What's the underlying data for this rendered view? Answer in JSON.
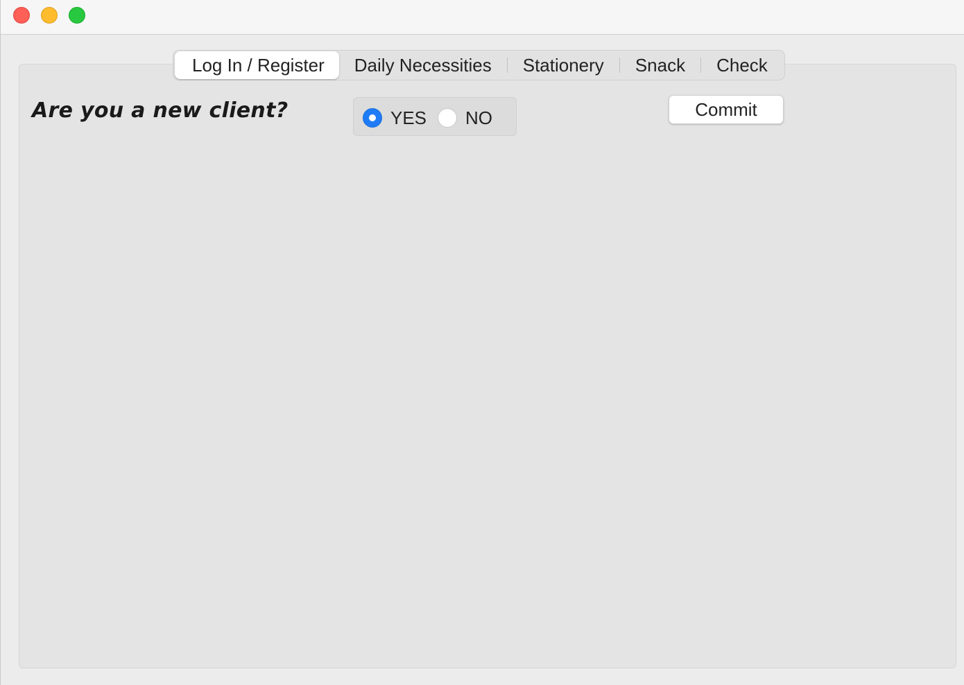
{
  "window": {
    "controls": [
      "close",
      "minimize",
      "maximize"
    ]
  },
  "tabs": [
    {
      "label": "Log In / Register",
      "selected": true
    },
    {
      "label": "Daily Necessities",
      "selected": false
    },
    {
      "label": "Stationery",
      "selected": false
    },
    {
      "label": "Snack",
      "selected": false
    },
    {
      "label": "Check",
      "selected": false
    }
  ],
  "login": {
    "question": "Are you a new client?",
    "options": [
      {
        "label": "YES",
        "selected": true
      },
      {
        "label": "NO",
        "selected": false
      }
    ],
    "commit_label": "Commit"
  },
  "colors": {
    "accent": "#1f7cf6",
    "close": "#fe5f57",
    "minimize": "#febc2e",
    "maximize": "#28c840"
  }
}
